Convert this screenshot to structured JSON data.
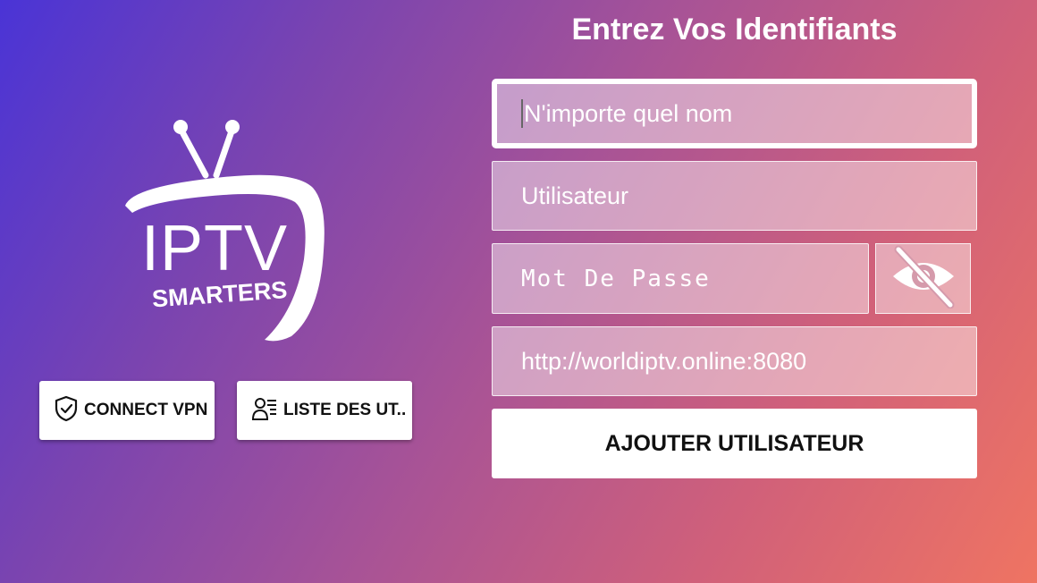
{
  "logo": {
    "line1": "IPTV",
    "line2": "SMARTERS"
  },
  "left_buttons": {
    "vpn_label": "CONNECT VPN",
    "vpn_icon": "shield-check-icon",
    "users_label": "LISTE DES UT..",
    "users_icon": "user-list-icon"
  },
  "form": {
    "title": "Entrez Vos Identifiants",
    "name_placeholder": "N'importe quel nom",
    "username_placeholder": "Utilisateur",
    "password_placeholder": "Mot De Passe",
    "password_toggle_icon": "eye-off-icon",
    "url_value": "http://worldiptv.online:8080",
    "submit_label": "AJOUTER UTILISATEUR"
  },
  "colors": {
    "gradient_start": "#4a34d6",
    "gradient_end": "#ef7462",
    "button_bg": "#ffffff",
    "text_light": "#ffffff"
  }
}
